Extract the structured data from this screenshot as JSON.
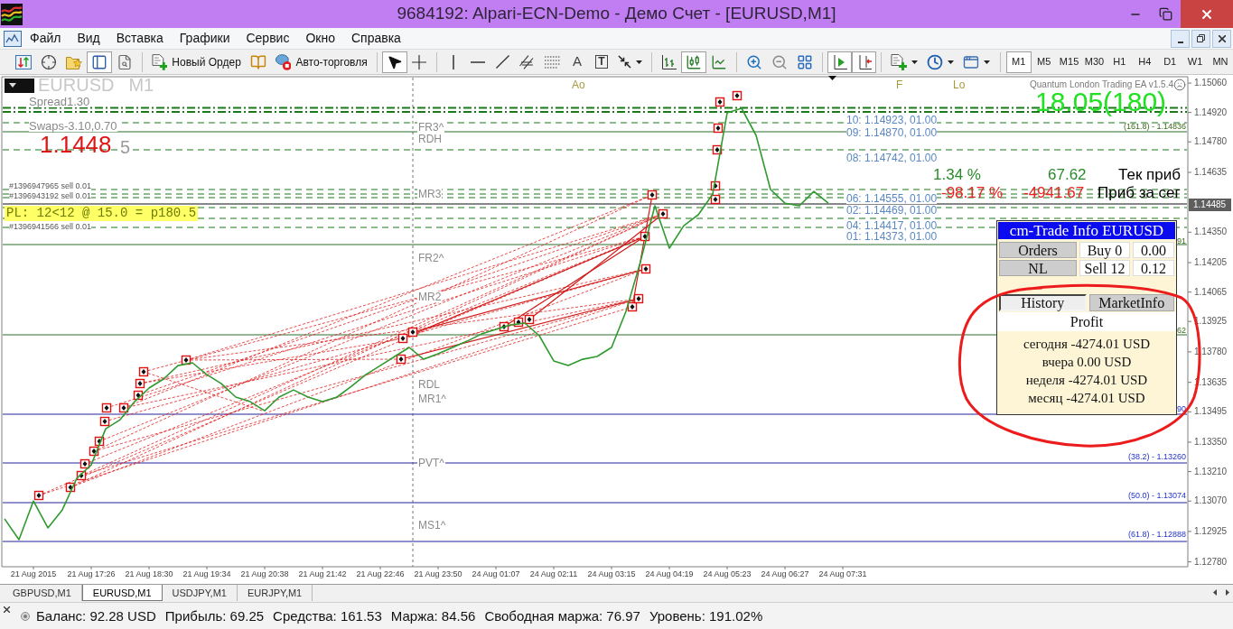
{
  "window": {
    "title": "9684192: Alpari-ECN-Demo - Демо Счет - [EURUSD,M1]"
  },
  "menu": [
    "Файл",
    "Вид",
    "Вставка",
    "Графики",
    "Сервис",
    "Окно",
    "Справка"
  ],
  "toolbar": [
    [
      {
        "kind": "new-chart",
        "selected": false
      },
      {
        "kind": "target",
        "selected": false
      },
      {
        "kind": "favorites",
        "selected": false
      },
      {
        "kind": "navigator",
        "selected": true
      },
      {
        "kind": "history-search",
        "selected": false
      }
    ],
    [
      {
        "kind": "new-order",
        "label": "Новый Ордер",
        "selected": false
      },
      {
        "kind": "editor",
        "selected": false
      },
      {
        "kind": "auto-trading",
        "label": "Авто-торговля",
        "selected": false
      }
    ],
    [
      {
        "kind": "cursor",
        "selected": true
      },
      {
        "kind": "crosshair",
        "selected": false
      }
    ],
    [
      {
        "kind": "vline",
        "selected": false
      },
      {
        "kind": "hline",
        "selected": false
      },
      {
        "kind": "trendline",
        "selected": false
      },
      {
        "kind": "channel",
        "selected": false
      },
      {
        "kind": "fibo",
        "selected": false
      },
      {
        "kind": "text",
        "label": "A",
        "selected": false
      },
      {
        "kind": "text-label",
        "label": "T",
        "selected": false
      },
      {
        "kind": "arrows-menu",
        "selected": false
      }
    ],
    [
      {
        "kind": "bars",
        "selected": false
      },
      {
        "kind": "candles",
        "selected": true
      },
      {
        "kind": "line",
        "selected": false
      }
    ],
    [
      {
        "kind": "zoom-in",
        "selected": false
      },
      {
        "kind": "zoom-out",
        "selected": false
      },
      {
        "kind": "tile",
        "selected": false
      }
    ],
    [
      {
        "kind": "autoscroll",
        "selected": true
      },
      {
        "kind": "shift",
        "selected": true
      }
    ],
    [
      {
        "kind": "indicators-menu",
        "selected": false
      },
      {
        "kind": "periods-menu",
        "selected": false
      },
      {
        "kind": "templates-menu",
        "selected": false
      }
    ]
  ],
  "timeframes": [
    {
      "label": "M1",
      "selected": true
    },
    {
      "label": "M5",
      "selected": false
    },
    {
      "label": "M15",
      "selected": false
    },
    {
      "label": "M30",
      "selected": false
    },
    {
      "label": "H1",
      "selected": false
    },
    {
      "label": "H4",
      "selected": false
    },
    {
      "label": "D1",
      "selected": false
    },
    {
      "label": "W1",
      "selected": false
    },
    {
      "label": "MN",
      "selected": false
    }
  ],
  "chart": {
    "symbol": "EURUSD",
    "period": "M1",
    "spread": "Spread1.30",
    "swaps": "Swaps-3.10,0.70",
    "price": "1.1448",
    "price_digit": "5",
    "order_labels": [
      "#1396947965 sell 0.01",
      "#1396943192 sell 0.01",
      "#1396941566 sell 0.01"
    ],
    "pl_box": "PL: 12<12 @ 15.0 = p180.5",
    "top_labels": [
      "Ao",
      "F",
      "Lo"
    ],
    "ea_name": "Quantum London Trading EA v1.5.4",
    "ea_pips": "18.05(180)",
    "grid_levels": [
      "10: 1.14923, 01.00",
      "09: 1.14870, 01.00",
      "08: 1.14742, 01.00",
      "06: 1.14555, 01.00",
      "02: 1.14469, 01.00",
      "04: 1.14417, 01.00",
      "01: 1.14373, 01.00"
    ],
    "stats": [
      {
        "percent": "1.34 %",
        "amount": "67.62",
        "label": "Тек приб",
        "positive": true
      },
      {
        "percent": "-98.17 %",
        "amount": "-4941.67",
        "label": "Приб за сег",
        "positive": false
      }
    ],
    "pivot_labels": [
      "FR3^",
      "RDH",
      "MR3",
      "FR2^",
      "MR2",
      "RDL",
      "MR1^",
      "PVT^",
      "MS1^"
    ],
    "fibo_labels": [
      "(161.8) - 1.14836",
      "91",
      "62",
      "90",
      "(38.2) - 1.13260",
      "(50.0) - 1.13074",
      "(61.8) - 1.12888"
    ],
    "current_price": "1.14485",
    "chart_data": {
      "type": "line",
      "categories": [
        null,
        null,
        "21 Aug 2015",
        null,
        null,
        null,
        "21 Aug 17:26",
        null,
        null,
        null,
        "21 Aug 18:30",
        null,
        null,
        null,
        "21 Aug 19:34",
        null,
        null,
        null,
        "21 Aug 20:38",
        null,
        null,
        null,
        "21 Aug 21:42",
        null,
        null,
        null,
        "21 Aug 22:46",
        null,
        null,
        null,
        "21 Aug 23:50",
        null,
        null,
        null,
        "24 Aug 01:07",
        null,
        null,
        null,
        "24 Aug 02:11",
        null,
        null,
        null,
        "24 Aug 03:15",
        null,
        null,
        null,
        "24 Aug 04:19",
        null,
        null,
        null,
        "24 Aug 05:23",
        null,
        null,
        null,
        "24 Aug 06:27",
        null,
        null,
        null,
        "24 Aug 07:31"
      ],
      "series": [
        {
          "color": "#2f9a2f",
          "values": [
            1.12985,
            1.12886,
            1.1307,
            1.12942,
            1.13028,
            1.13178,
            1.13242,
            1.13414,
            1.13457,
            1.13543,
            1.13608,
            1.13651,
            1.13715,
            1.13728,
            1.13672,
            1.13629,
            1.13565,
            1.13543,
            1.135,
            1.13565,
            1.13599,
            1.13565,
            1.13543,
            1.13565,
            1.13616,
            1.13672,
            1.13715,
            1.13758,
            1.13801,
            1.13745,
            1.13771,
            1.13801,
            1.13831,
            1.13865,
            1.13887,
            1.13908,
            1.13917,
            1.13857,
            1.13737,
            1.13715,
            1.13745,
            1.13758,
            1.13801,
            1.13973,
            1.14209,
            1.14476,
            1.14274,
            1.14381,
            1.14433,
            1.14531,
            1.14918,
            1.1494,
            1.14811,
            1.14553,
            1.14488,
            1.14476,
            1.14544,
            1.14488,
            null
          ]
        }
      ],
      "ylim": [
        1.12757,
        1.15086
      ],
      "yticks": [
        {
          "value": 1.1506,
          "label": "1.15060"
        },
        {
          "value": 1.1492,
          "label": "1.14920"
        },
        {
          "value": 1.1478,
          "label": "1.14780"
        },
        {
          "value": 1.14635,
          "label": "1.14635"
        },
        {
          "value": 1.1435,
          "label": "1.14350"
        },
        {
          "value": 1.14205,
          "label": "1.14205"
        },
        {
          "value": 1.14065,
          "label": "1.14065"
        },
        {
          "value": 1.13925,
          "label": "1.13925"
        },
        {
          "value": 1.1378,
          "label": "1.13780"
        },
        {
          "value": 1.13635,
          "label": "1.13635"
        },
        {
          "value": 1.13495,
          "label": "1.13495"
        },
        {
          "value": 1.1335,
          "label": "1.13350"
        },
        {
          "value": 1.1321,
          "label": "1.13210"
        },
        {
          "value": 1.1307,
          "label": "1.13070"
        },
        {
          "value": 1.12925,
          "label": "1.12925"
        },
        {
          "value": 1.1278,
          "label": "1.12780"
        }
      ]
    }
  },
  "trade_panel": {
    "title": "cm-Trade Info EURUSD",
    "rows": [
      {
        "button": "Orders",
        "side": "Buy 0",
        "volume": "0.00"
      },
      {
        "button": "NL",
        "side": "Sell 12",
        "volume": "0.12"
      }
    ],
    "tabs": [
      {
        "label": "History",
        "selected": true
      },
      {
        "label": "MarketInfo",
        "selected": false
      }
    ],
    "section": "Profit",
    "profit_lines": [
      "сегодня -4274.01 USD",
      "вчера 0.00 USD",
      "неделя -4274.01 USD",
      "месяц -4274.01 USD"
    ]
  },
  "chart_tabs": [
    {
      "label": "GBPUSD,M1",
      "selected": false
    },
    {
      "label": "EURUSD,M1",
      "selected": true
    },
    {
      "label": "USDJPY,M1",
      "selected": false
    },
    {
      "label": "EURJPY,M1",
      "selected": false
    }
  ],
  "status_bar": [
    "Баланс: 92.28 USD",
    "Прибыль: 69.25",
    "Средства: 161.53",
    "Маржа: 84.56",
    "Свободная маржа: 76.97",
    "Уровень: 191.02%"
  ]
}
